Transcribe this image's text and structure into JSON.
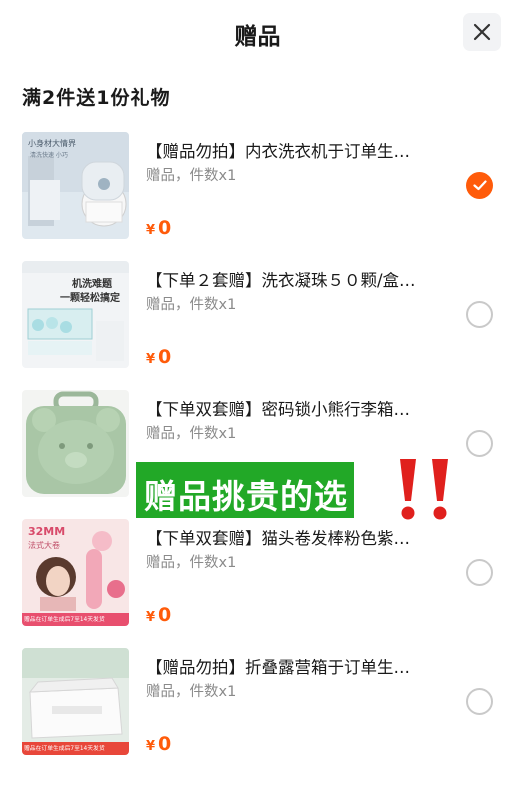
{
  "header": {
    "title": "赠品",
    "close_icon": "close-icon"
  },
  "promo": {
    "text": "满2件送1份礼物"
  },
  "items": [
    {
      "name": "【赠品勿拍】内衣洗衣机于订单生…",
      "meta": "赠品，件数x1",
      "currency": "¥",
      "price": "0",
      "selected": true,
      "thumb": {
        "line1": "小身材大情界",
        "line2": "清洗快速 小巧"
      }
    },
    {
      "name": "【下单２套赠】洗衣凝珠５０颗/盒…",
      "meta": "赠品，件数x1",
      "currency": "¥",
      "price": "0",
      "selected": false,
      "thumb": {
        "line1": "机洗难题",
        "line2": "一颗轻松搞定"
      }
    },
    {
      "name": "【下单双套赠】密码锁小熊行李箱…",
      "meta": "赠品，件数x1",
      "currency": "¥",
      "price": "",
      "selected": false,
      "thumb": {
        "line1": "",
        "line2": ""
      }
    },
    {
      "name": "【下单双套赠】猫头卷发棒粉色紫…",
      "meta": "赠品，件数x1",
      "currency": "¥",
      "price": "0",
      "selected": false,
      "thumb": {
        "line1": "32MM",
        "line2": "法式大卷",
        "footer": "赠品在订单生成后7至14天发货"
      }
    },
    {
      "name": "【赠品勿拍】折叠露营箱于订单生…",
      "meta": "赠品，件数x1",
      "currency": "¥",
      "price": "0",
      "selected": false,
      "thumb": {
        "line1": "",
        "line2": "",
        "footer": "赠品在订单生成后7至14天发货"
      }
    }
  ],
  "overlay": {
    "text": "赠品挑贵的选"
  },
  "colors": {
    "accent": "#ff5b0a",
    "overlay_bg": "#22a827",
    "exclaim": "#e0201d"
  }
}
